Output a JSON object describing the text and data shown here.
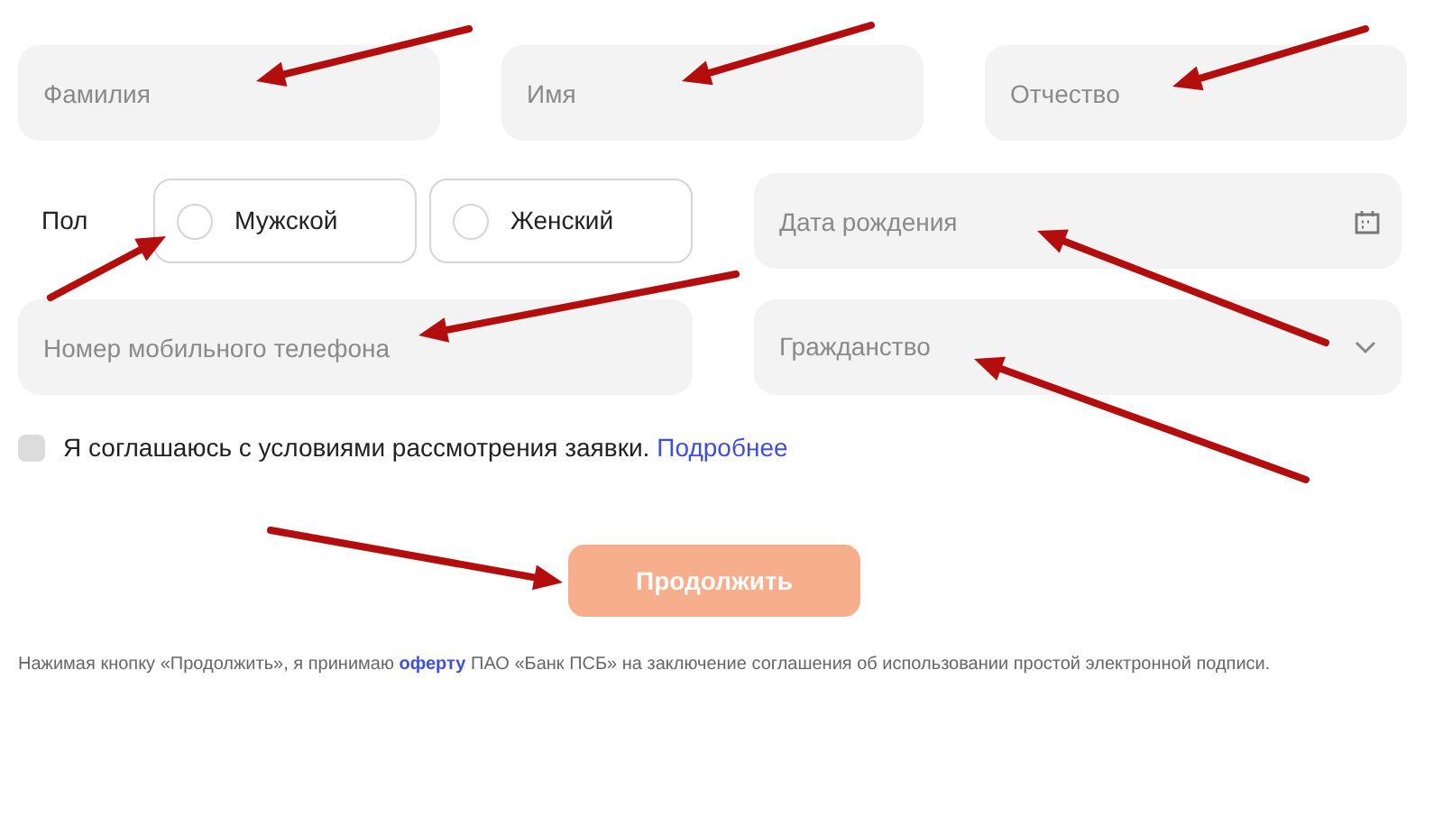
{
  "name_fields": [
    {
      "placeholder": "Фамилия"
    },
    {
      "placeholder": "Имя"
    },
    {
      "placeholder": "Отчество"
    }
  ],
  "gender": {
    "label": "Пол",
    "options": [
      {
        "label": "Мужской",
        "selected": false
      },
      {
        "label": "Женский",
        "selected": false
      }
    ]
  },
  "birth_date": {
    "placeholder": "Дата рождения"
  },
  "phone": {
    "placeholder": "Номер мобильного телефона"
  },
  "citizenship": {
    "placeholder": "Гражданство"
  },
  "consent": {
    "checked": false,
    "text": "Я соглашаюсь с условиями рассмотрения заявки.",
    "link": "Подробнее"
  },
  "submit": {
    "label": "Продолжить",
    "disabled": true
  },
  "footer": {
    "before": "Нажимая кнопку «Продолжить», я принимаю",
    "link": "оферту",
    "after": "ПАО «Банк ПСБ» на заключение соглашения об использовании простой электронной подписи."
  }
}
